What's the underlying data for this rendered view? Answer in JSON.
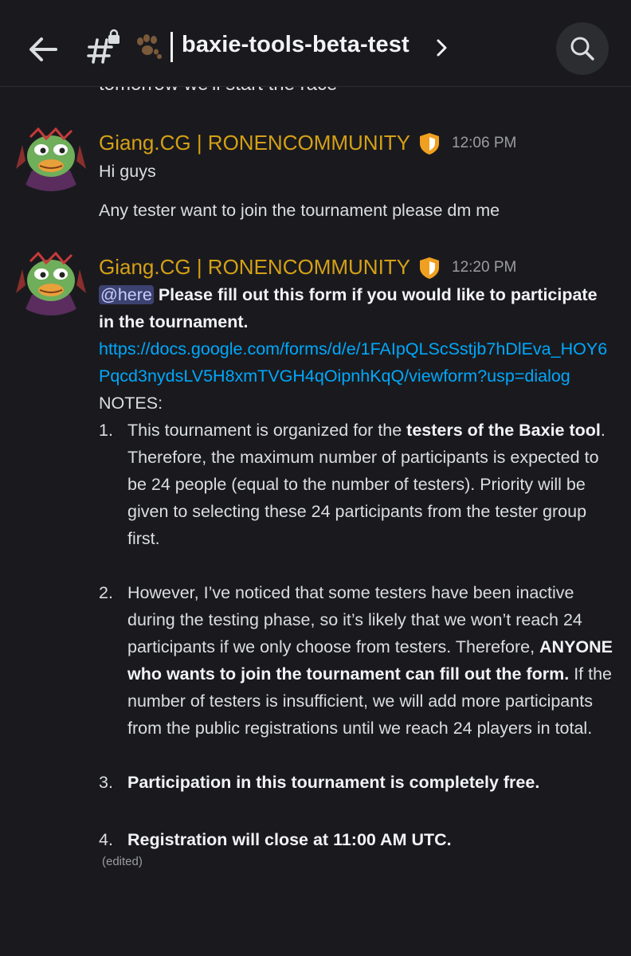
{
  "header": {
    "channel_name": "baxie-tools-beta-test",
    "channel_emoji": "paw"
  },
  "previous_message_partial": "tomorrow we'll start the race",
  "messages": [
    {
      "author": "Giang.CG | RONENCOMMUNITY",
      "time": "12:06 PM",
      "lines": [
        "Hi guys",
        "Any tester want to join the tournament please dm me"
      ]
    },
    {
      "author": "Giang.CG | RONENCOMMUNITY",
      "time": "12:20 PM",
      "mention": "@here",
      "intro_bold": " Please fill out this form if you would like to participate in the tournament.",
      "link": "https://docs.google.com/forms/d/e/1FAIpQLScSstjb7hDlEva_HOY6Pqcd3nydsLV5H8xmTVGH4qOipnhKqQ/viewform?usp=dialog",
      "notes_label": "NOTES:",
      "notes": [
        {
          "number": "1.",
          "a": "This tournament is organized for the ",
          "b_bold": "testers of the Baxie tool",
          "c": ". Therefore, the maximum number of participants is expected to be 24 people (equal to the number of testers). Priority will be given to selecting these 24 participants from the tester group first."
        },
        {
          "number": "2.",
          "a": "However, I’ve noticed that some testers have been inactive during the testing phase, so it’s likely that we won’t reach 24 participants if we only choose from testers. Therefore, ",
          "b_bold": "ANYONE who wants to join the tournament can fill out the form.",
          "c": " If the number of testers is insufficient, we will add more participants from the public registrations until we reach 24 players in total."
        },
        {
          "number": "3.",
          "a": "",
          "b_bold": "Participation in this tournament is completely free.",
          "c": ""
        },
        {
          "number": "4.",
          "a": "",
          "b_bold": "Registration will close at 11:00 AM UTC.",
          "c": ""
        }
      ],
      "edited_label": "(edited)"
    }
  ],
  "colors": {
    "background": "#1a1a1e",
    "author": "#d4a017",
    "link": "#00a8fc",
    "mention_bg": "#3c4270",
    "shield": "#f0a020"
  }
}
